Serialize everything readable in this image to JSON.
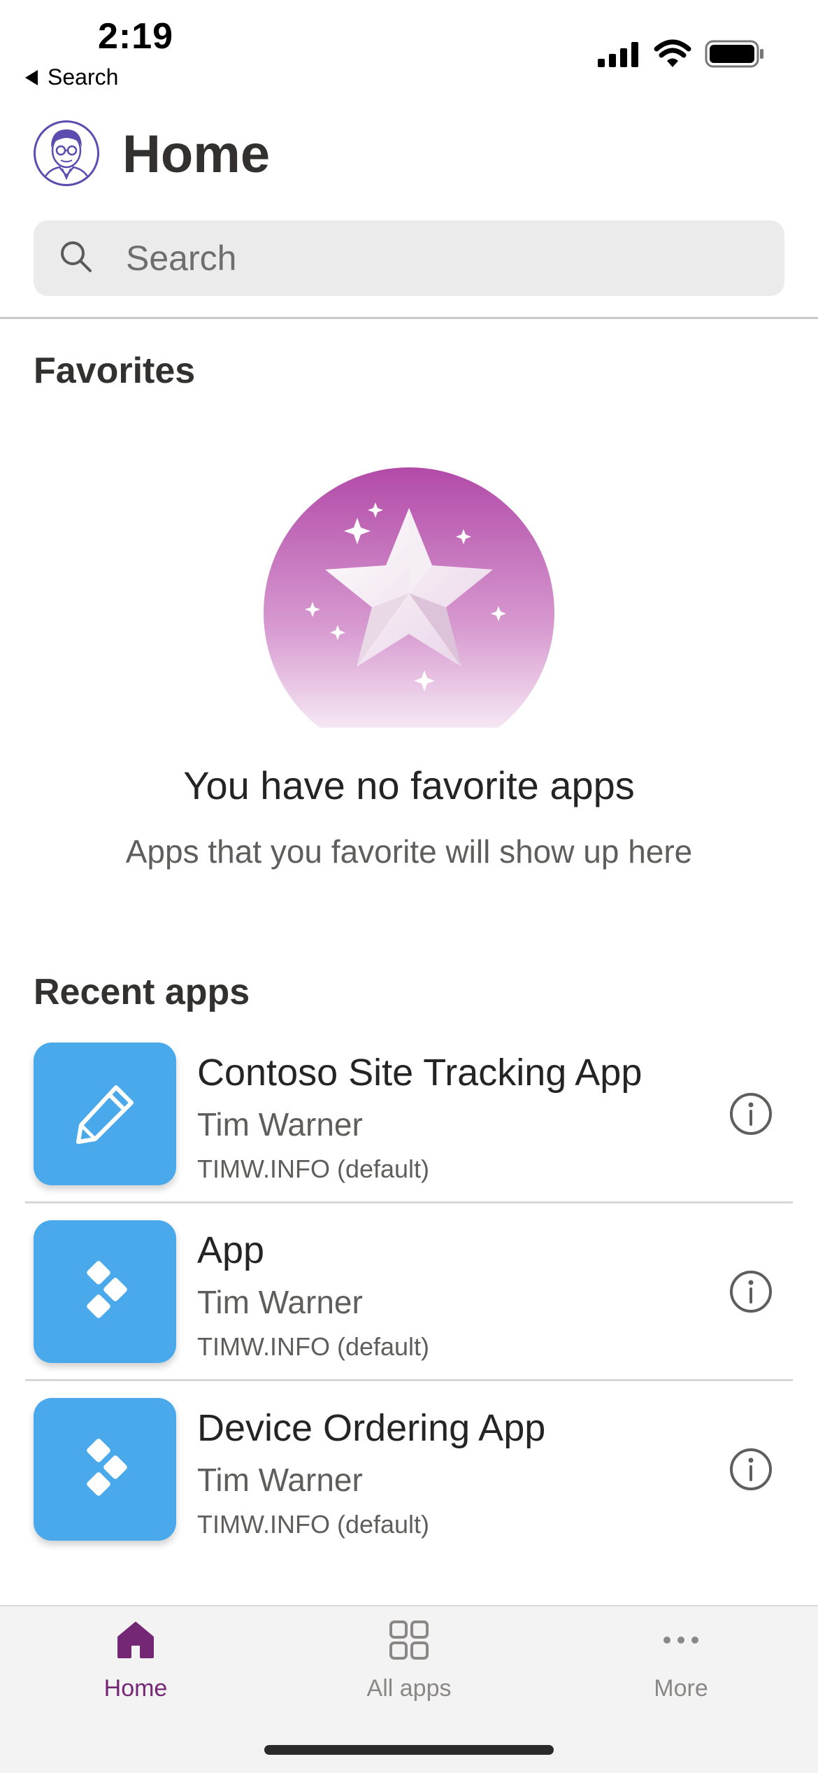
{
  "status_bar": {
    "time": "2:19",
    "back_label": "Search"
  },
  "header": {
    "title": "Home"
  },
  "search": {
    "placeholder": "Search"
  },
  "favorites": {
    "section_title": "Favorites",
    "empty_title": "You have no favorite apps",
    "empty_subtitle": "Apps that you favorite will show up here"
  },
  "recent": {
    "section_title": "Recent apps",
    "apps": [
      {
        "name": "Contoso Site Tracking App",
        "owner": "Tim Warner",
        "environment": "TIMW.INFO (default)",
        "icon": "pencil-icon"
      },
      {
        "name": "App",
        "owner": "Tim Warner",
        "environment": "TIMW.INFO (default)",
        "icon": "power-apps-diamonds-icon"
      },
      {
        "name": "Device Ordering App",
        "owner": "Tim Warner",
        "environment": "TIMW.INFO (default)",
        "icon": "power-apps-diamonds-icon"
      }
    ]
  },
  "tab_bar": {
    "tabs": [
      {
        "label": "Home",
        "icon": "home-icon",
        "active": true
      },
      {
        "label": "All apps",
        "icon": "grid-icon",
        "active": false
      },
      {
        "label": "More",
        "icon": "more-dots-icon",
        "active": false
      }
    ]
  },
  "colors": {
    "accent": "#742774",
    "app_tile": "#4aa9ea",
    "search_background": "#ebebeb",
    "tab_bar_background": "#f3f3f3"
  }
}
